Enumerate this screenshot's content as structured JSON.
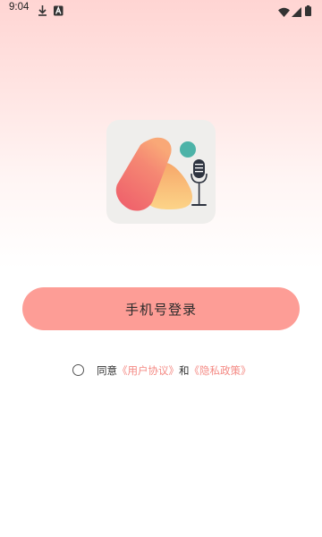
{
  "status_bar": {
    "time": "9:04",
    "left_icons": [
      "download-icon",
      "font-a-icon"
    ],
    "right_icons": [
      "wifi-icon",
      "signal-icon",
      "battery-icon"
    ]
  },
  "logo": {
    "icon": "microphone-icon"
  },
  "login": {
    "button_label": "手机号登录"
  },
  "agreement": {
    "prefix": "同意",
    "user_agreement": "《用户协议》",
    "conjunction": "和",
    "privacy_policy": "《隐私政策》",
    "checked": false
  },
  "colors": {
    "accent": "#fd9d96",
    "link": "#f48a84",
    "logo_gradient_start": "#f06b6f",
    "logo_gradient_end": "#fccf82",
    "mic_dot": "#4db3a8"
  }
}
